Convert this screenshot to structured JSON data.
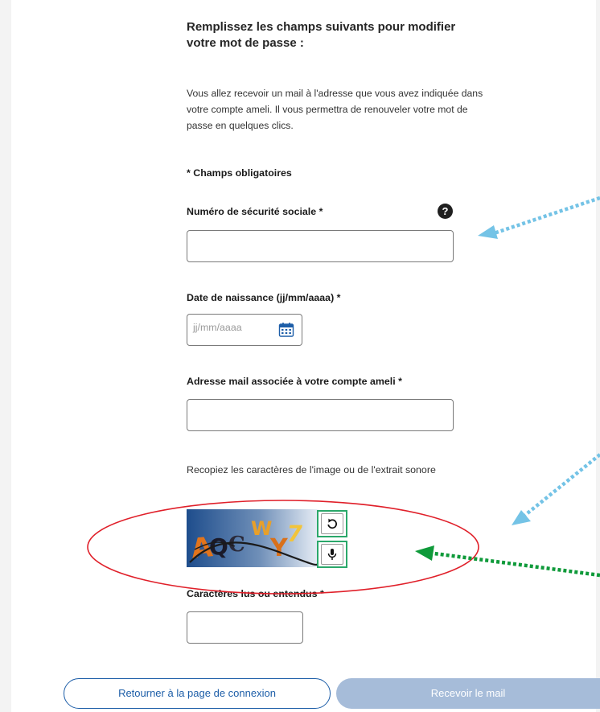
{
  "form": {
    "title": "Remplissez les champs suivants pour modifier votre mot de passe :",
    "intro": "Vous allez recevoir un mail à l'adresse que vous avez indiquée dans votre compte ameli. Il vous permettra de renouveler votre mot de passe en quelques clics.",
    "required_note": "* Champs obligatoires",
    "ssn": {
      "label": "Numéro de sécurité sociale *",
      "help_glyph": "?",
      "value": ""
    },
    "birthdate": {
      "label": "Date de naissance (jj/mm/aaaa) *",
      "placeholder": "jj/mm/aaaa",
      "icon": "calendar-icon"
    },
    "email": {
      "label": "Adresse mail associée à votre compte ameli *",
      "value": ""
    },
    "captcha": {
      "instruction": "Recopiez les caractères de l'image ou de l'extrait sonore",
      "image_text": "AQCWY7",
      "refresh_icon": "refresh-icon",
      "audio_icon": "microphone-icon"
    },
    "characters": {
      "label": "Caractères lus ou entendus *",
      "value": ""
    }
  },
  "buttons": {
    "back": "Retourner à la page de connexion",
    "send": "Recevoir le mail"
  },
  "annotations": {
    "highlight_color": "#e0202a",
    "frame_color": "#2aa86a",
    "arrow_blue": "#74c3e6",
    "arrow_green": "#0f9a3a"
  }
}
